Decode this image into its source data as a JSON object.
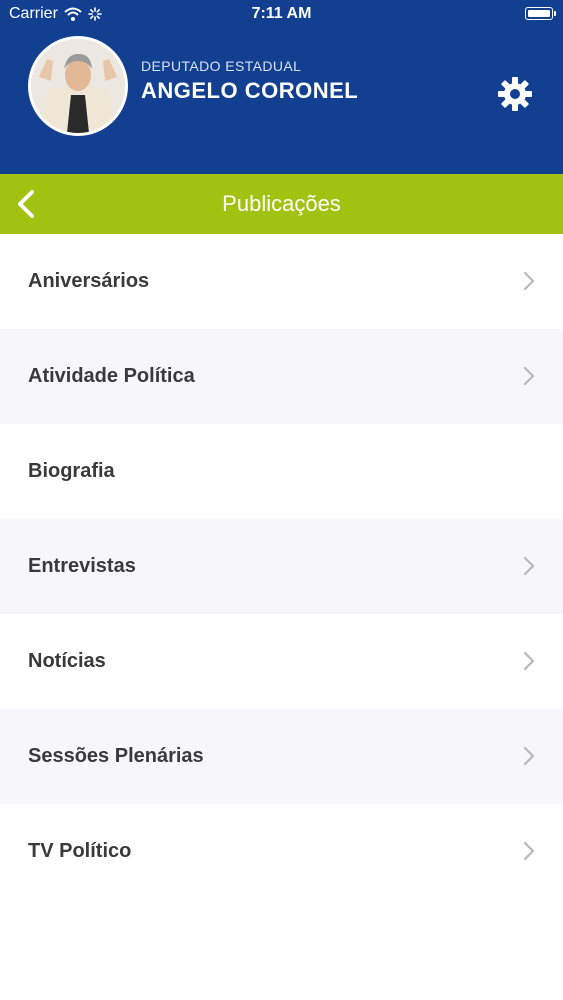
{
  "status_bar": {
    "carrier": "Carrier",
    "time": "7:11 AM"
  },
  "header": {
    "role": "DEPUTADO ESTADUAL",
    "name": "ANGELO CORONEL"
  },
  "navbar": {
    "title": "Publicações"
  },
  "list": {
    "items": [
      {
        "label": "Aniversários",
        "chevron": true
      },
      {
        "label": "Atividade Política",
        "chevron": true
      },
      {
        "label": "Biografia",
        "chevron": false
      },
      {
        "label": "Entrevistas",
        "chevron": true
      },
      {
        "label": "Notícias",
        "chevron": true
      },
      {
        "label": "Sessões Plenárias",
        "chevron": true
      },
      {
        "label": "TV Político",
        "chevron": true
      }
    ]
  },
  "colors": {
    "header_bg": "#123f8f",
    "navbar_bg": "#a2c212",
    "text": "#3a3a3a",
    "chevron": "#b8b8bd"
  }
}
